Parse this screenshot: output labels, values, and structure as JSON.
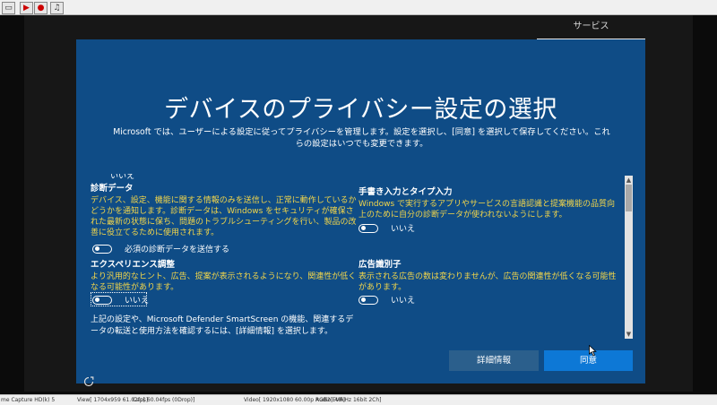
{
  "toolbar": {
    "buttons": [
      {
        "icon": "window-icon",
        "glyph": "▭"
      },
      {
        "icon": "play-icon",
        "glyph": "▶"
      },
      {
        "icon": "record-icon",
        "glyph": "●"
      },
      {
        "icon": "music-icon",
        "glyph": "♫"
      }
    ]
  },
  "oobe": {
    "services_tab": "サービス",
    "title": "デバイスのプライバシー設定の選択",
    "intro": "Microsoft では、ユーザーによる設定に従ってプライバシーを管理します。設定を選択し、[同意] を選択して保存してください。これらの設定はいつでも変更できます。",
    "partial_label": "いいえ",
    "settings": {
      "diagnostics": {
        "title": "診断データ",
        "desc": "デバイス、設定、機能に関する情報のみを送信し、正常に動作しているかどうかを通知します。診断データは、Windows をセキュリティが確保された最新の状態に保ち、問題のトラブルシューティングを行い、製品の改善に役立てるために使用されます。",
        "toggle_label": "必須の診断データを送信する"
      },
      "experience": {
        "title": "エクスペリエンス調整",
        "desc": "より汎用的なヒント、広告、提案が表示されるようになり、関連性が低くなる可能性があります。",
        "toggle_label": "いいえ"
      },
      "inking": {
        "title": "手書き入力とタイプ入力",
        "desc": "Windows で実行するアプリやサービスの言語認識と提案機能の品質向上のために自分の診断データが使われないようにします。",
        "toggle_label": "いいえ"
      },
      "ads": {
        "title": "広告識別子",
        "desc": "表示される広告の数は変わりませんが、広告の関連性が低くなる可能性があります。",
        "toggle_label": "いいえ"
      }
    },
    "footnote": "上記の設定や、Microsoft Defender SmartScreen の機能、関連するデータの転送と使用方法を確認するには、[詳細情報] を選択します。",
    "learn_more": "詳細情報",
    "accept": "同意"
  },
  "statusbar": {
    "app": "me Capture HD(k) 5",
    "view": "View[ 1704x959 61.02fps]",
    "cap": "Cap[ 60.04fps (0Drop)]",
    "video": "Video[ 1920x1080 60.00p RGB2 EVR]",
    "audio": "Audio[ 48kHz 16bit 2Ch]"
  },
  "colors": {
    "panel": "#0f4c86",
    "accent_button": "#0d78d6",
    "secondary_button": "#2b5f8c",
    "description_text": "#f3d64a"
  }
}
